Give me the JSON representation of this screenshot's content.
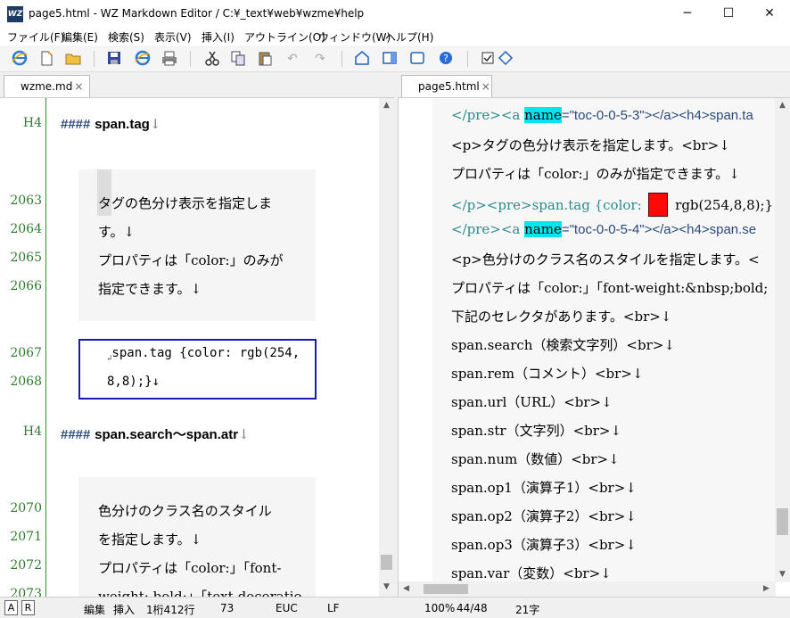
{
  "window": {
    "title": "page5.html - WZ Markdown Editor / C:¥_text¥web¥wzme¥help",
    "icon_text": "WZ",
    "minimize": "─",
    "maximize": "☐",
    "close": "✕"
  },
  "menu": [
    "ファイル(F)",
    "編集(E)",
    "検索(S)",
    "表示(V)",
    "挿入(I)",
    "アウトライン(O)",
    "ウィンドウ(W)",
    "ヘルプ(H)"
  ],
  "tabs": {
    "left": "wzme.md",
    "right": "page5.html",
    "close": "×"
  },
  "left": {
    "h1": {
      "label": "H4",
      "hash": "####",
      "text": "span.tag",
      "ret": "↓"
    },
    "p1": {
      "lines": [
        "タグの色分け表示を指定しま",
        "す。↓",
        "プロパティは「color:」のみが",
        "指定できます。↓"
      ],
      "nums": [
        "2063",
        "2064",
        "2065",
        "2066"
      ]
    },
    "code": {
      "lines": [
        "span.tag {color: rgb(254,",
        "8,8);}↓"
      ],
      "nums": [
        "2067",
        "2068"
      ]
    },
    "h2": {
      "label": "H4",
      "hash": "####",
      "text": "span.search～span.atr",
      "ret": "↓"
    },
    "p2": {
      "lines": [
        "色分けのクラス名のスタイル",
        "を指定します。↓",
        "プロパティは「color:」「font-",
        "weight: bold;」「text-decoratio"
      ],
      "nums": [
        "2070",
        "2071",
        "2072",
        "2073"
      ]
    }
  },
  "right": {
    "lines": [
      {
        "pre": "</pre><a ",
        "name": "name",
        "post": "=\"toc-0-0-5-3\"></a><h4>span.ta"
      },
      {
        "text": "<p>タグの色分け表示を指定します。<br>↓"
      },
      {
        "text": "プロパティは「color:」のみが指定できます。↓"
      },
      {
        "pre": "</p><pre>span.tag {color: ",
        "post": " rgb(254,8,8);}↓"
      },
      {
        "pre": "</pre><a ",
        "name": "name",
        "post": "=\"toc-0-0-5-4\"></a><h4>span.se"
      },
      {
        "text": "<p>色分けのクラス名のスタイルを指定します。<"
      },
      {
        "text": "プロパティは「color:」「font-weight:&nbsp;bold;"
      },
      {
        "text": "下記のセレクタがあります。<br>↓"
      },
      {
        "text": "span.search（検索文字列）<br>↓"
      },
      {
        "text": "span.rem（コメント）<br>↓"
      },
      {
        "text": "span.url（URL）<br>↓"
      },
      {
        "text": "span.str（文字列）<br>↓"
      },
      {
        "text": "span.num（数値）<br>↓"
      },
      {
        "text": "span.op1（演算子1）<br>↓"
      },
      {
        "text": "span.op2（演算子2）<br>↓"
      },
      {
        "text": "span.op3（演算子3）<br>↓"
      },
      {
        "text": "span.var（変数）<br>↓"
      }
    ],
    "swatch_color": "#fe0808"
  },
  "status": {
    "a": "A",
    "r": "R",
    "mode": "編集",
    "insert": "挿入",
    "pos": "1桁412行",
    "col": "73",
    "enc": "EUC",
    "eol": "LF",
    "zoom": "100%",
    "page": "44/48",
    "chars": "21字"
  }
}
